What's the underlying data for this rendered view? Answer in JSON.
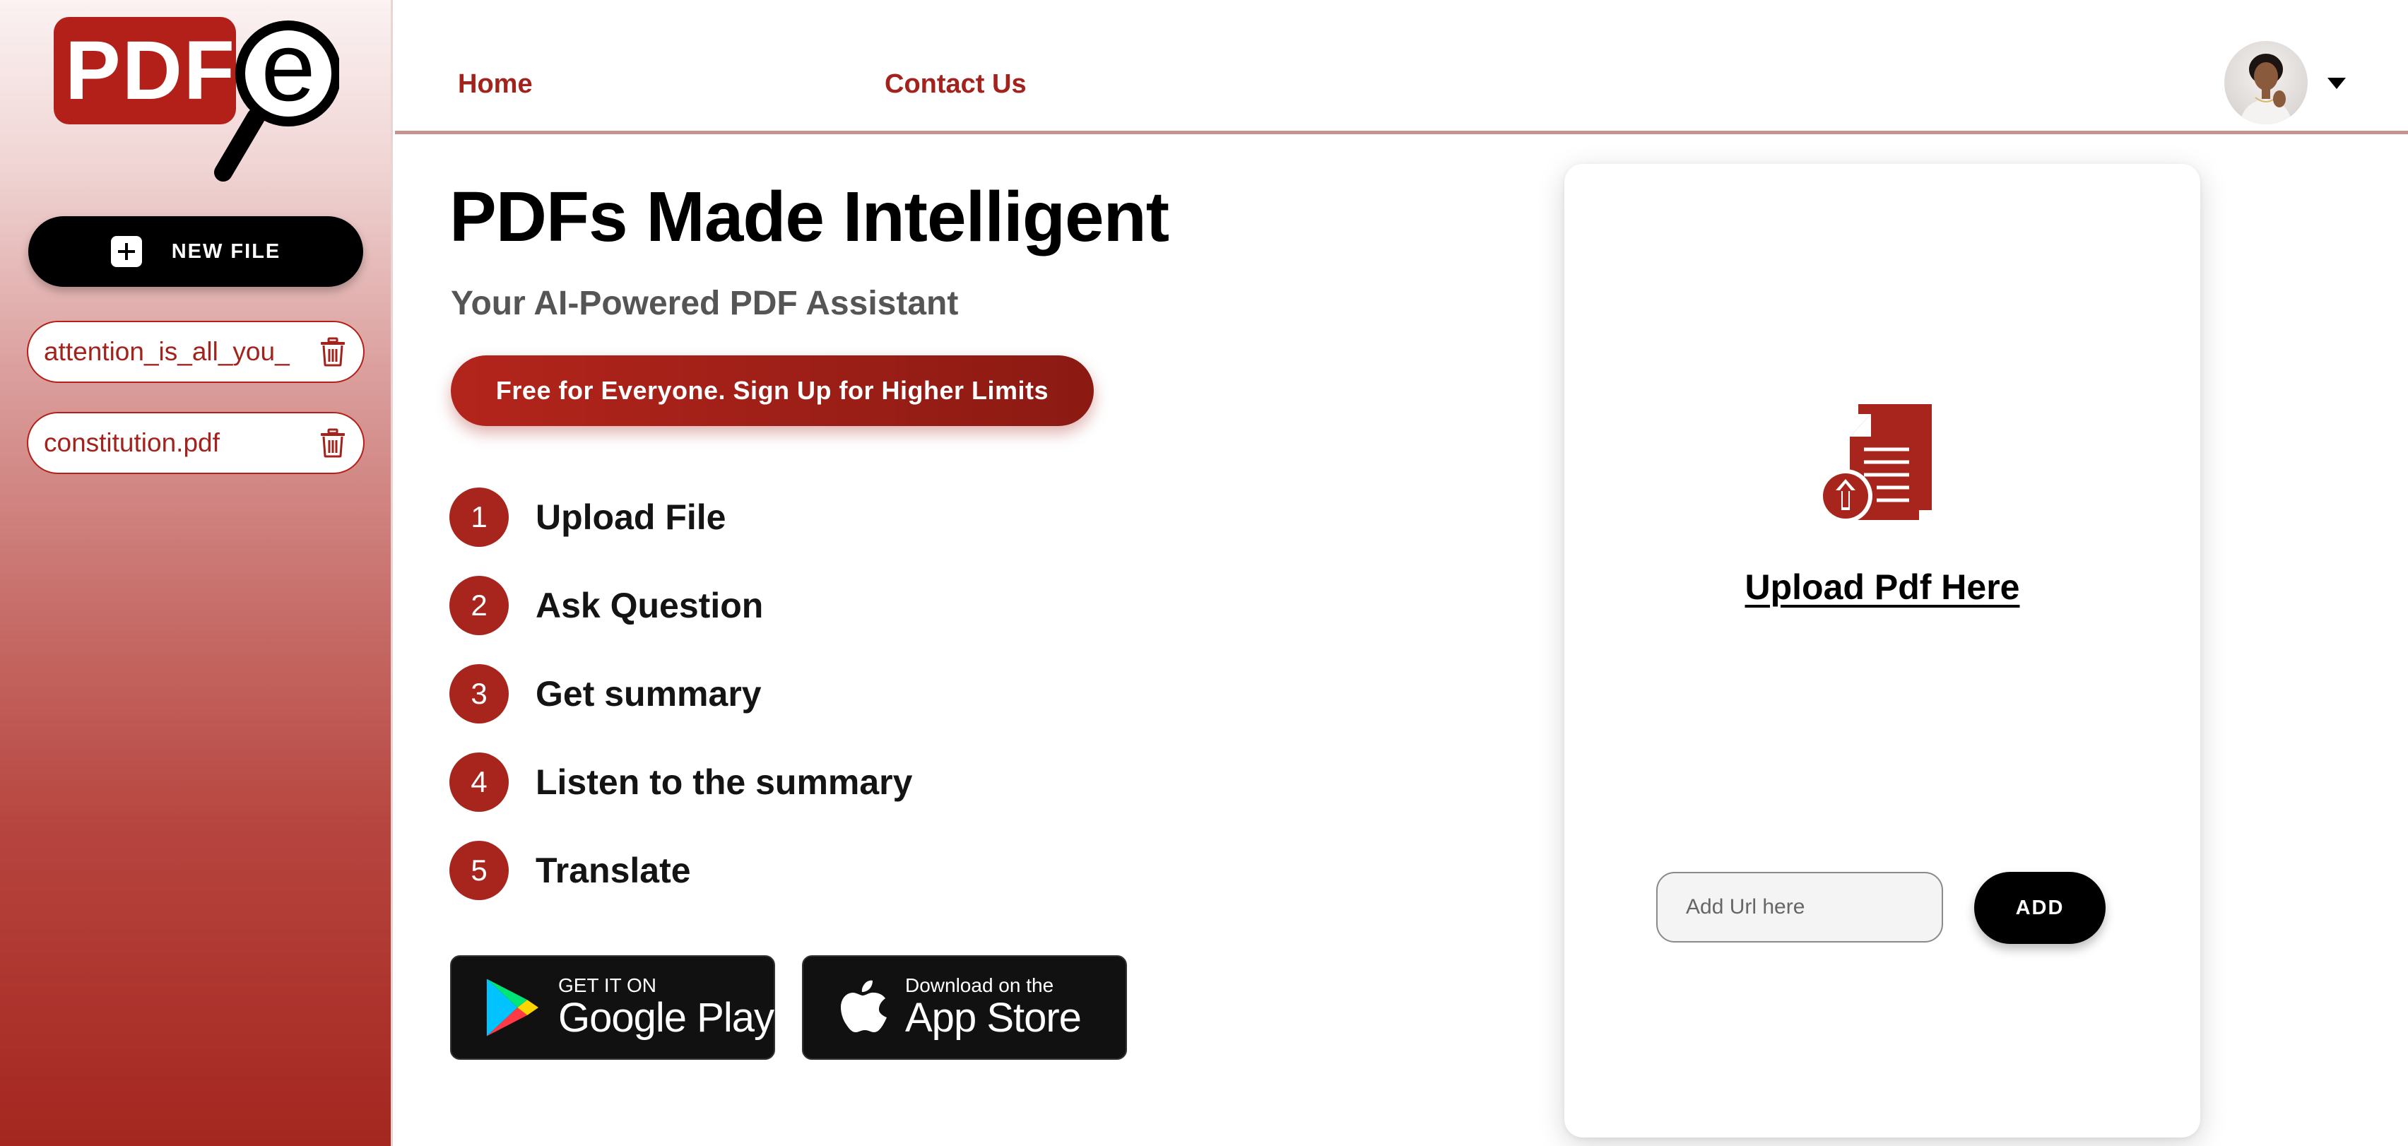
{
  "brand": {
    "logo_text": "PDF",
    "logo_letter": "e"
  },
  "sidebar": {
    "new_file_label": "NEW FILE",
    "files": [
      {
        "name": "attention_is_all_you_"
      },
      {
        "name": "constitution.pdf"
      }
    ]
  },
  "header": {
    "nav": [
      {
        "label": "Home"
      },
      {
        "label": "Contact Us"
      }
    ],
    "avatar_icon": "user-avatar",
    "menu_icon": "caret-down-icon"
  },
  "hero": {
    "title": "PDFs Made Intelligent",
    "subtitle": "Your AI-Powered PDF Assistant",
    "cta_label": "Free for Everyone. Sign Up for Higher Limits"
  },
  "steps": [
    {
      "number": "1",
      "label": "Upload File"
    },
    {
      "number": "2",
      "label": "Ask Question"
    },
    {
      "number": "3",
      "label": "Get summary"
    },
    {
      "number": "4",
      "label": "Listen to the summary"
    },
    {
      "number": "5",
      "label": "Translate"
    }
  ],
  "stores": {
    "google": {
      "small": "GET IT ON",
      "big": "Google Play"
    },
    "apple": {
      "small": "Download on the",
      "big": "App Store"
    }
  },
  "upload": {
    "label": "Upload Pdf Here",
    "url_placeholder": "Add Url here",
    "add_label": "ADD"
  },
  "colors": {
    "brand_red": "#a3221c",
    "black": "#000000"
  }
}
